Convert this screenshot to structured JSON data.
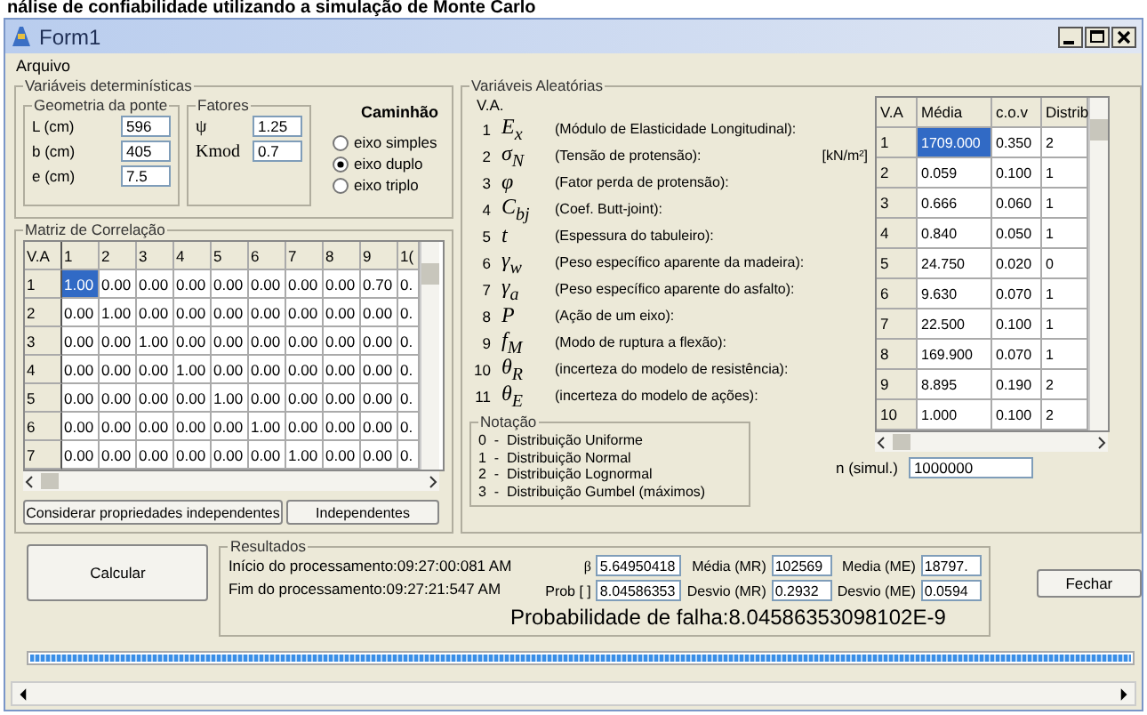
{
  "page_caption": "nálise de confiabilidade utilizando a simulação de Monte Carlo",
  "window": {
    "title": "Form1"
  },
  "menu": [
    "Arquivo"
  ],
  "deterministic": {
    "title": "Variáveis determinísticas",
    "geometry": {
      "title": "Geometria da ponte",
      "fields": [
        {
          "label": "L (cm)",
          "value": "596"
        },
        {
          "label": "b (cm)",
          "value": "405"
        },
        {
          "label": "e (cm)",
          "value": "7.5"
        }
      ]
    },
    "factors": {
      "title": "Fatores",
      "fields": [
        {
          "label": "ψ",
          "value": "1.25"
        },
        {
          "label": "Kmod",
          "value": "0.7"
        }
      ]
    },
    "truck": {
      "title": "Caminhão",
      "options": [
        {
          "label": "eixo simples",
          "selected": false
        },
        {
          "label": "eixo duplo",
          "selected": true
        },
        {
          "label": "eixo triplo",
          "selected": false
        }
      ]
    }
  },
  "correlation": {
    "title": "Matriz de Correlação",
    "corner": "V.A",
    "columns": [
      "1",
      "2",
      "3",
      "4",
      "5",
      "6",
      "7",
      "8",
      "9",
      "1("
    ],
    "rows": [
      {
        "header": "1",
        "cells": [
          {
            "v": "1.00",
            "selected": true
          },
          {
            "v": "0.00",
            "selected": false
          },
          {
            "v": "0.00",
            "selected": false
          },
          {
            "v": "0.00",
            "selected": false
          },
          {
            "v": "0.00",
            "selected": false
          },
          {
            "v": "0.00",
            "selected": false
          },
          {
            "v": "0.00",
            "selected": false
          },
          {
            "v": "0.00",
            "selected": false
          },
          {
            "v": "0.70",
            "selected": false
          },
          {
            "v": "0.",
            "selected": false
          }
        ]
      },
      {
        "header": "2",
        "cells": [
          {
            "v": "0.00",
            "selected": false
          },
          {
            "v": "1.00",
            "selected": false
          },
          {
            "v": "0.00",
            "selected": false
          },
          {
            "v": "0.00",
            "selected": false
          },
          {
            "v": "0.00",
            "selected": false
          },
          {
            "v": "0.00",
            "selected": false
          },
          {
            "v": "0.00",
            "selected": false
          },
          {
            "v": "0.00",
            "selected": false
          },
          {
            "v": "0.00",
            "selected": false
          },
          {
            "v": "0.",
            "selected": false
          }
        ]
      },
      {
        "header": "3",
        "cells": [
          {
            "v": "0.00",
            "selected": false
          },
          {
            "v": "0.00",
            "selected": false
          },
          {
            "v": "1.00",
            "selected": false
          },
          {
            "v": "0.00",
            "selected": false
          },
          {
            "v": "0.00",
            "selected": false
          },
          {
            "v": "0.00",
            "selected": false
          },
          {
            "v": "0.00",
            "selected": false
          },
          {
            "v": "0.00",
            "selected": false
          },
          {
            "v": "0.00",
            "selected": false
          },
          {
            "v": "0.",
            "selected": false
          }
        ]
      },
      {
        "header": "4",
        "cells": [
          {
            "v": "0.00",
            "selected": false
          },
          {
            "v": "0.00",
            "selected": false
          },
          {
            "v": "0.00",
            "selected": false
          },
          {
            "v": "1.00",
            "selected": false
          },
          {
            "v": "0.00",
            "selected": false
          },
          {
            "v": "0.00",
            "selected": false
          },
          {
            "v": "0.00",
            "selected": false
          },
          {
            "v": "0.00",
            "selected": false
          },
          {
            "v": "0.00",
            "selected": false
          },
          {
            "v": "0.",
            "selected": false
          }
        ]
      },
      {
        "header": "5",
        "cells": [
          {
            "v": "0.00",
            "selected": false
          },
          {
            "v": "0.00",
            "selected": false
          },
          {
            "v": "0.00",
            "selected": false
          },
          {
            "v": "0.00",
            "selected": false
          },
          {
            "v": "1.00",
            "selected": false
          },
          {
            "v": "0.00",
            "selected": false
          },
          {
            "v": "0.00",
            "selected": false
          },
          {
            "v": "0.00",
            "selected": false
          },
          {
            "v": "0.00",
            "selected": false
          },
          {
            "v": "0.",
            "selected": false
          }
        ]
      },
      {
        "header": "6",
        "cells": [
          {
            "v": "0.00",
            "selected": false
          },
          {
            "v": "0.00",
            "selected": false
          },
          {
            "v": "0.00",
            "selected": false
          },
          {
            "v": "0.00",
            "selected": false
          },
          {
            "v": "0.00",
            "selected": false
          },
          {
            "v": "1.00",
            "selected": false
          },
          {
            "v": "0.00",
            "selected": false
          },
          {
            "v": "0.00",
            "selected": false
          },
          {
            "v": "0.00",
            "selected": false
          },
          {
            "v": "0.",
            "selected": false
          }
        ]
      },
      {
        "header": "7",
        "cells": [
          {
            "v": "0.00",
            "selected": false
          },
          {
            "v": "0.00",
            "selected": false
          },
          {
            "v": "0.00",
            "selected": false
          },
          {
            "v": "0.00",
            "selected": false
          },
          {
            "v": "0.00",
            "selected": false
          },
          {
            "v": "0.00",
            "selected": false
          },
          {
            "v": "1.00",
            "selected": false
          },
          {
            "v": "0.00",
            "selected": false
          },
          {
            "v": "0.00",
            "selected": false
          },
          {
            "v": "0.",
            "selected": false
          }
        ]
      }
    ]
  },
  "matrix_buttons": [
    "Considerar propriedades independentes",
    "Independentes"
  ],
  "random": {
    "title": "Variáveis Aleatórias",
    "header": "V.A.",
    "variables": [
      {
        "number": "1",
        "symbol": "E$_{x}$",
        "description": "(Módulo de Elasticidade Longitudinal):"
      },
      {
        "number": "2",
        "symbol": "σ$_{N}$",
        "description": "(Tensão de protensão):",
        "unit": "[kN/m²]"
      },
      {
        "number": "3",
        "symbol": "φ",
        "description": "(Fator perda de protensão):"
      },
      {
        "number": "4",
        "symbol": "C$_{bj}$",
        "description": "(Coef. Butt-joint):"
      },
      {
        "number": "5",
        "symbol": "t",
        "description": "(Espessura do tabuleiro):"
      },
      {
        "number": "6",
        "symbol": "γ$_{w}$",
        "description": "(Peso específico aparente da madeira):"
      },
      {
        "number": "7",
        "symbol": "γ$_{a}$",
        "description": "(Peso específico aparente do asfalto):"
      },
      {
        "number": "8",
        "symbol": "P",
        "description": "(Ação de um eixo):"
      },
      {
        "number": "9",
        "symbol": "f$_{M}$",
        "description": "(Modo de ruptura a flexão):"
      },
      {
        "number": "10",
        "symbol": "θ$_{R}$",
        "description": "(incerteza do modelo de resistência):"
      },
      {
        "number": "11",
        "symbol": "θ$_{E}$",
        "description": "(incerteza do modelo de ações):"
      }
    ],
    "notation": {
      "title": "Notação",
      "items": [
        "0  -  Distribuição Uniforme",
        "1  -  Distribuição Normal",
        "2  -  Distribuição Lognormal",
        "3  -  Distribuição Gumbel (máximos)"
      ]
    },
    "table": {
      "columns": [
        "V.A",
        "Média",
        "c.o.v",
        "Distrib"
      ],
      "rows": [
        {
          "cells": [
            {
              "v": "1",
              "selected": false
            },
            {
              "v": "1709.000",
              "selected": true
            },
            {
              "v": "0.350",
              "selected": false
            },
            {
              "v": "2",
              "selected": false
            }
          ]
        },
        {
          "cells": [
            {
              "v": "2",
              "selected": false
            },
            {
              "v": "0.059",
              "selected": false
            },
            {
              "v": "0.100",
              "selected": false
            },
            {
              "v": "1",
              "selected": false
            }
          ]
        },
        {
          "cells": [
            {
              "v": "3",
              "selected": false
            },
            {
              "v": "0.666",
              "selected": false
            },
            {
              "v": "0.060",
              "selected": false
            },
            {
              "v": "1",
              "selected": false
            }
          ]
        },
        {
          "cells": [
            {
              "v": "4",
              "selected": false
            },
            {
              "v": "0.840",
              "selected": false
            },
            {
              "v": "0.050",
              "selected": false
            },
            {
              "v": "1",
              "selected": false
            }
          ]
        },
        {
          "cells": [
            {
              "v": "5",
              "selected": false
            },
            {
              "v": "24.750",
              "selected": false
            },
            {
              "v": "0.020",
              "selected": false
            },
            {
              "v": "0",
              "selected": false
            }
          ]
        },
        {
          "cells": [
            {
              "v": "6",
              "selected": false
            },
            {
              "v": "9.630",
              "selected": false
            },
            {
              "v": "0.070",
              "selected": false
            },
            {
              "v": "1",
              "selected": false
            }
          ]
        },
        {
          "cells": [
            {
              "v": "7",
              "selected": false
            },
            {
              "v": "22.500",
              "selected": false
            },
            {
              "v": "0.100",
              "selected": false
            },
            {
              "v": "1",
              "selected": false
            }
          ]
        },
        {
          "cells": [
            {
              "v": "8",
              "selected": false
            },
            {
              "v": "169.900",
              "selected": false
            },
            {
              "v": "0.070",
              "selected": false
            },
            {
              "v": "1",
              "selected": false
            }
          ]
        },
        {
          "cells": [
            {
              "v": "9",
              "selected": false
            },
            {
              "v": "8.895",
              "selected": false
            },
            {
              "v": "0.190",
              "selected": false
            },
            {
              "v": "2",
              "selected": false
            }
          ]
        },
        {
          "cells": [
            {
              "v": "10",
              "selected": false
            },
            {
              "v": "1.000",
              "selected": false
            },
            {
              "v": "0.100",
              "selected": false
            },
            {
              "v": "2",
              "selected": false
            }
          ]
        }
      ]
    },
    "n_simul": {
      "label": "n (simul.)",
      "value": "1000000"
    }
  },
  "calculate_button": "Calcular",
  "results": {
    "title": "Resultados",
    "start": "Início do processamento:09:27:00:081 AM",
    "end": "Fim do processamento:09:27:21:547 AM",
    "fields": [
      {
        "label": "β",
        "value": "5.64950418"
      },
      {
        "label": "Média (MR)",
        "value": "102569"
      },
      {
        "label": "Media (ME)",
        "value": "18797."
      },
      {
        "label": "Prob [ ]",
        "value": "8.04586353"
      },
      {
        "label": "Desvio (MR)",
        "value": "0.2932"
      },
      {
        "label": "Desvio (ME)",
        "value": "0.0594"
      }
    ],
    "probability": "Probabilidade de falha:8.04586353098102E-9"
  },
  "close_button": "Fechar",
  "progress": {
    "level": 1
  }
}
